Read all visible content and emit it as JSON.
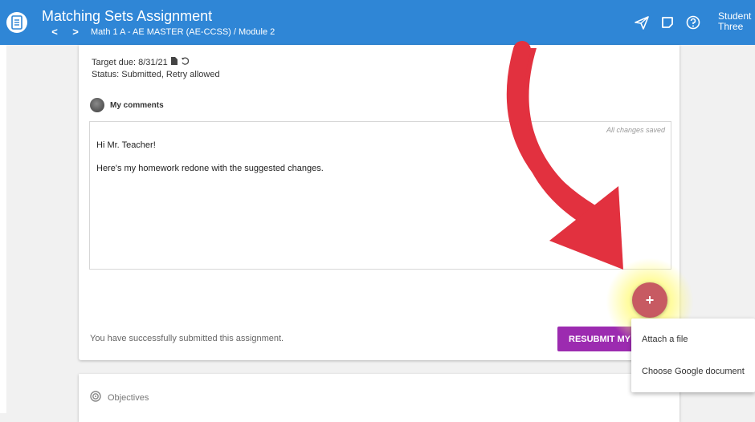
{
  "header": {
    "title": "Matching Sets Assignment",
    "breadcrumb": "Math 1 A - AE MASTER (AE-CCSS) / Module 2",
    "back_glyph": "<",
    "forward_glyph": ">",
    "user_line1": "Student",
    "user_line2": "Three",
    "icons": [
      "document-icon",
      "send-icon",
      "note-icon",
      "help-icon"
    ]
  },
  "assignment": {
    "target_due": "Target due: 8/31/21",
    "status": "Status: Submitted, Retry allowed"
  },
  "comments": {
    "heading": "My comments",
    "save_status": "All changes saved",
    "paragraphs": [
      "Hi Mr. Teacher!",
      "Here's my homework redone with the suggested changes."
    ]
  },
  "footer": {
    "submitted_message": "You have successfully submitted this assignment.",
    "resubmit_label": "RESUBMIT MY"
  },
  "objectives": {
    "label": "Objectives"
  },
  "fab": {
    "glyph": "+"
  },
  "attach_menu": {
    "items": [
      "Attach a file",
      "Choose Google document"
    ]
  },
  "colors": {
    "header_bg": "#2f86d6",
    "resubmit_bg": "#9c2bb0",
    "fab_bg": "#c75a62",
    "arrow": "#e2313f"
  }
}
